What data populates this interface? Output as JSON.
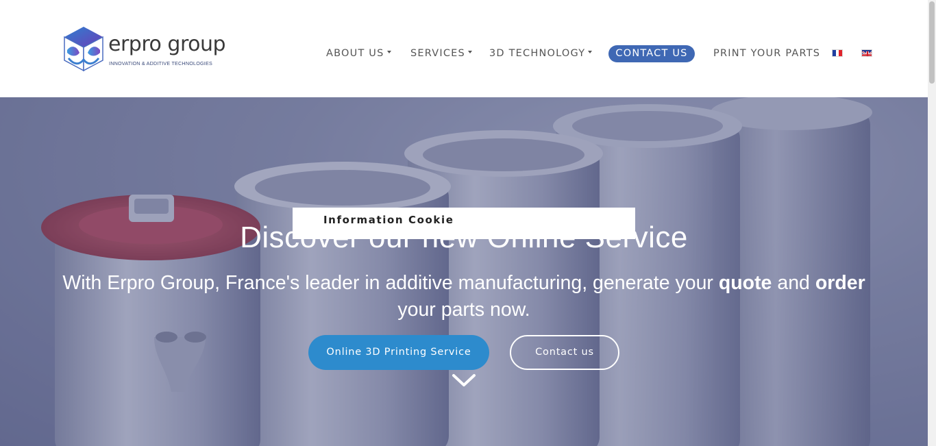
{
  "logo": {
    "name": "erpro group",
    "tagline": "INNOVATION & ADDITIVE TECHNOLOGIES"
  },
  "nav": {
    "about": "ABOUT US",
    "services": "SERVICES",
    "technology": "3D TECHNOLOGY",
    "contact": "CONTACT US",
    "print": "PRINT YOUR PARTS",
    "lang_fr_icon": "french-flag-icon",
    "lang_en_icon": "uk-flag-icon"
  },
  "hero": {
    "title": "Discover our new Online Service",
    "subtitle_pre": "With Erpro Group, France's leader in additive manufacturing, generate your ",
    "subtitle_quote": "quote",
    "subtitle_mid": " and ",
    "subtitle_order": "order",
    "subtitle_post": " your parts now.",
    "primary_button": "Online 3D Printing Service",
    "secondary_button": "Contact us",
    "scroll_icon": "chevron-down-icon"
  },
  "cookie": {
    "title": "Information Cookie"
  },
  "colors": {
    "nav_contact_bg": "#3f68b4",
    "primary_button_bg": "#2d8bcd",
    "hero_overlay": "#485282",
    "nav_text": "#555555"
  }
}
